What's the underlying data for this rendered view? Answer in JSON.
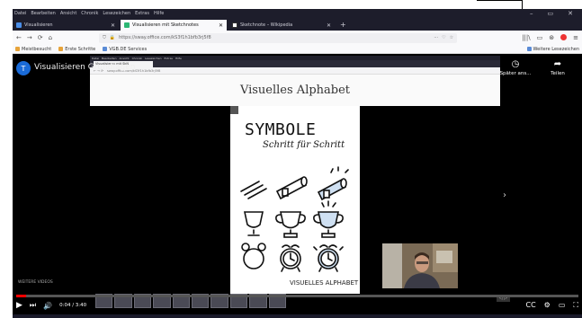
{
  "menubar": [
    "Datei",
    "Bearbeiten",
    "Ansicht",
    "Chronik",
    "Lesezeichen",
    "Extras",
    "Hilfe"
  ],
  "window_controls": [
    "–",
    "▭",
    "✕"
  ],
  "tabs": [
    {
      "label": "Visualisieren",
      "active": false
    },
    {
      "label": "Visualisieren mit Sketchnotes",
      "active": true
    },
    {
      "label": "Sketchnote – Wikipedia",
      "active": false
    }
  ],
  "new_tab": "+",
  "nav": {
    "back": "←",
    "forward": "→",
    "reload": "⟳",
    "home": "⌂",
    "url": "https://sway.office.com/kS3f1h1bfb3rj5f8",
    "more": "···",
    "right_icons": [
      "|||\\",
      "▭",
      "⊛",
      "≡"
    ]
  },
  "bookmarks": {
    "items": [
      "Meistbesucht",
      "Erste Schritte",
      "VGB.DE Services"
    ],
    "right": "Weitere Lesezeichen"
  },
  "player": {
    "channel_initial": "T",
    "title": "Visualisieren Grundlagen",
    "later_label": "Später ans...",
    "share_label": "Teilen",
    "later_icon": "◷",
    "share_icon": "➦",
    "watermark": "WEITERE VIDEOS",
    "time": "0:04 / 3:40",
    "progress": 0.0182
  },
  "inner_browser": {
    "menu": [
      "Datei",
      "Bearbeiten",
      "Ansicht",
      "Chronik",
      "Lesezeichen",
      "Extras",
      "Hilfe"
    ],
    "tab_label": "Visualisieren mit SkN",
    "url": "sway.office.com/kS3f1h1bfb3rj5f8",
    "document_title": "Visuelles Alphabet"
  },
  "slide": {
    "title": "SYMBOLE",
    "subtitle": "Schritt für Schritt",
    "footer": "VISUELLES ALPHABET"
  },
  "controls": {
    "play_icon": "▶",
    "next_icon": "⏭",
    "volume_icon": "🔊",
    "right_icons": [
      "CC",
      "⚙",
      "▭",
      "⛶"
    ],
    "mini_controls": "◁ ▷"
  },
  "colors": {
    "progress": "#ff0000",
    "avatar": "#1a6bd8",
    "chrome_dark": "#1d1d2b"
  }
}
